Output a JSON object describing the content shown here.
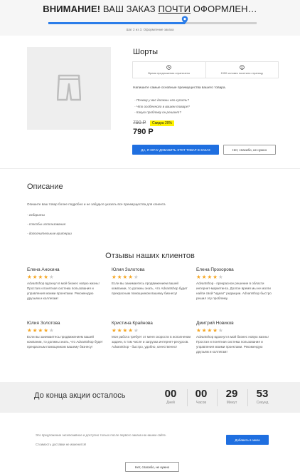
{
  "header": {
    "title_bold": "ВНИМАНИЕ!",
    "title_pre": " ВАШ ЗАКАЗ ",
    "title_underlined": "ПОЧТИ",
    "title_post": " ОФОРМЛЕН…",
    "progress_fraction": 0.655,
    "progress_color": "#2b7de9",
    "step_text": "Шаг 2 из 3. Оформление заказа"
  },
  "product": {
    "image_icon": "shorts-placeholder-icon",
    "name": "Шорты",
    "info": [
      {
        "icon": "clock-icon",
        "text": "Время предложения ограничено"
      },
      {
        "icon": "smile-icon",
        "text": "1990 человек посетили страницу"
      }
    ],
    "benefits_title": "Напишите самые основные преимущества вашего товара.",
    "questions": [
      "- Почему у вас должны его купить?",
      "- Что особенного в вашем товаре?",
      "- Какую проблему он решает?"
    ],
    "old_price": "790 Р",
    "discount_label": "Скидка 20%",
    "new_price": "790 Р",
    "add_button": "ДА, Я ХОЧУ ДОБАВИТЬ ЭТОТ ТОВАР В ЗАКАЗ",
    "decline_button": "Нет, спасибо, не нужно",
    "accent_color": "#1f6fe0"
  },
  "description": {
    "title": "Описание",
    "text": "Опишите ваш товар более подробно и не забудьте указать все преимущества для клиента",
    "items": [
      "- габариты",
      "- способы использования",
      "- дополнительные критерии"
    ]
  },
  "reviews": {
    "title": "Отзывы наших клиентов",
    "star_color": "#f5a623",
    "star_empty_color": "#cccccc",
    "items": [
      {
        "name": "Елена Анохина",
        "rating": 4,
        "text": "Advantshop вдохнул в мой бизнес новую жизнь! Простая и понятная система пользования и управления моими проектами. Рекомендую друзьям и коллегам!"
      },
      {
        "name": "Юлия Золотова",
        "rating": 4,
        "text": "Если вы занимаетесь продвижением вашей компании, то должны знать, что Advantshop будет прекрасным помощником вашему бизнесу!"
      },
      {
        "name": "Елена Прохорова",
        "rating": 4,
        "text": "Advantshop - прекрасное решение в области интернет-маркетинга. Долгое время мы не могли найти свой \"идеал\" редакции. Advantshop быстро решил эту проблему."
      },
      {
        "name": "Юлия Золотова",
        "rating": 4,
        "text": "Если вы занимаетесь продвижением вашей компании, то должны знать, что Advantshop будет прекрасным помощником вашему бизнесу!"
      },
      {
        "name": "Кристина Крайнова",
        "rating": 4,
        "text": "Моя работа требует от меня скорости в исполнении задачи, в том числе и загрузка интернет-ресурсов. Advantshop - быстро, удобно, качественно!"
      },
      {
        "name": "Дмитрий Новиков",
        "rating": 4,
        "text": "Advantshop вдохнул в мой бизнес новую жизнь! Простая и понятная система пользования и управления моими проектами. Рекомендую друзьям и коллегам!"
      }
    ]
  },
  "countdown": {
    "label": "До конца акции осталось",
    "units": [
      {
        "value": "00",
        "caption": "Дней"
      },
      {
        "value": "00",
        "caption": "Часов"
      },
      {
        "value": "29",
        "caption": "Минут"
      },
      {
        "value": "53",
        "caption": "Секунд"
      }
    ]
  },
  "footer": {
    "text1": "Это предложение эксклюзивное и доступно только после первого заказа на нашем сайте.",
    "text2": "Стоимость доставки не изменится!",
    "add_button": "Добавить в заказ",
    "decline_button": "Нет, спасибо, не нужно"
  }
}
